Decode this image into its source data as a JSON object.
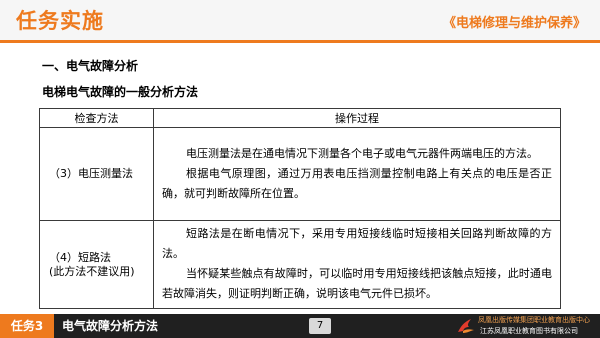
{
  "header": {
    "title": "任务实施",
    "book_title": "《电梯修理与维护保养》"
  },
  "content": {
    "section_heading": "一、电气故障分析",
    "sub_heading": "电梯电气故障的一般分析方法",
    "table": {
      "headers": [
        "检查方法",
        "操作过程"
      ],
      "rows": [
        {
          "method_lines": [
            "（3）电压测量法"
          ],
          "paragraphs": [
            "电压测量法是在通电情况下测量各个电子或电气元器件两端电压的方法。",
            "根据电气原理图，通过万用表电压挡测量控制电路上有关点的电压是否正确，就可判断故障所在位置。"
          ]
        },
        {
          "method_lines": [
            "（4）短路法",
            "(此方法不建议用)"
          ],
          "paragraphs": [
            "短路法是在断电情况下，采用专用短接线临时短接相关回路判断故障的方法。",
            "当怀疑某些触点有故障时，可以临时用专用短接线把该触点短接，此时通电若故障消失，则证明判断正确，说明该电气元件已损坏。"
          ]
        }
      ]
    }
  },
  "footer": {
    "task_label": "任务3",
    "topic": "电气故障分析方法",
    "page_number": "7",
    "publisher_line1": "凤凰出版传媒集团职业教育出版中心",
    "publisher_line2": "江苏凤凰职业教育图书有限公司",
    "logo_icon": "phoenix-logo-icon"
  },
  "colors": {
    "accent": "#ee7a1e",
    "footer_bg": "#202020",
    "header_bg": "#f6f6f6"
  }
}
